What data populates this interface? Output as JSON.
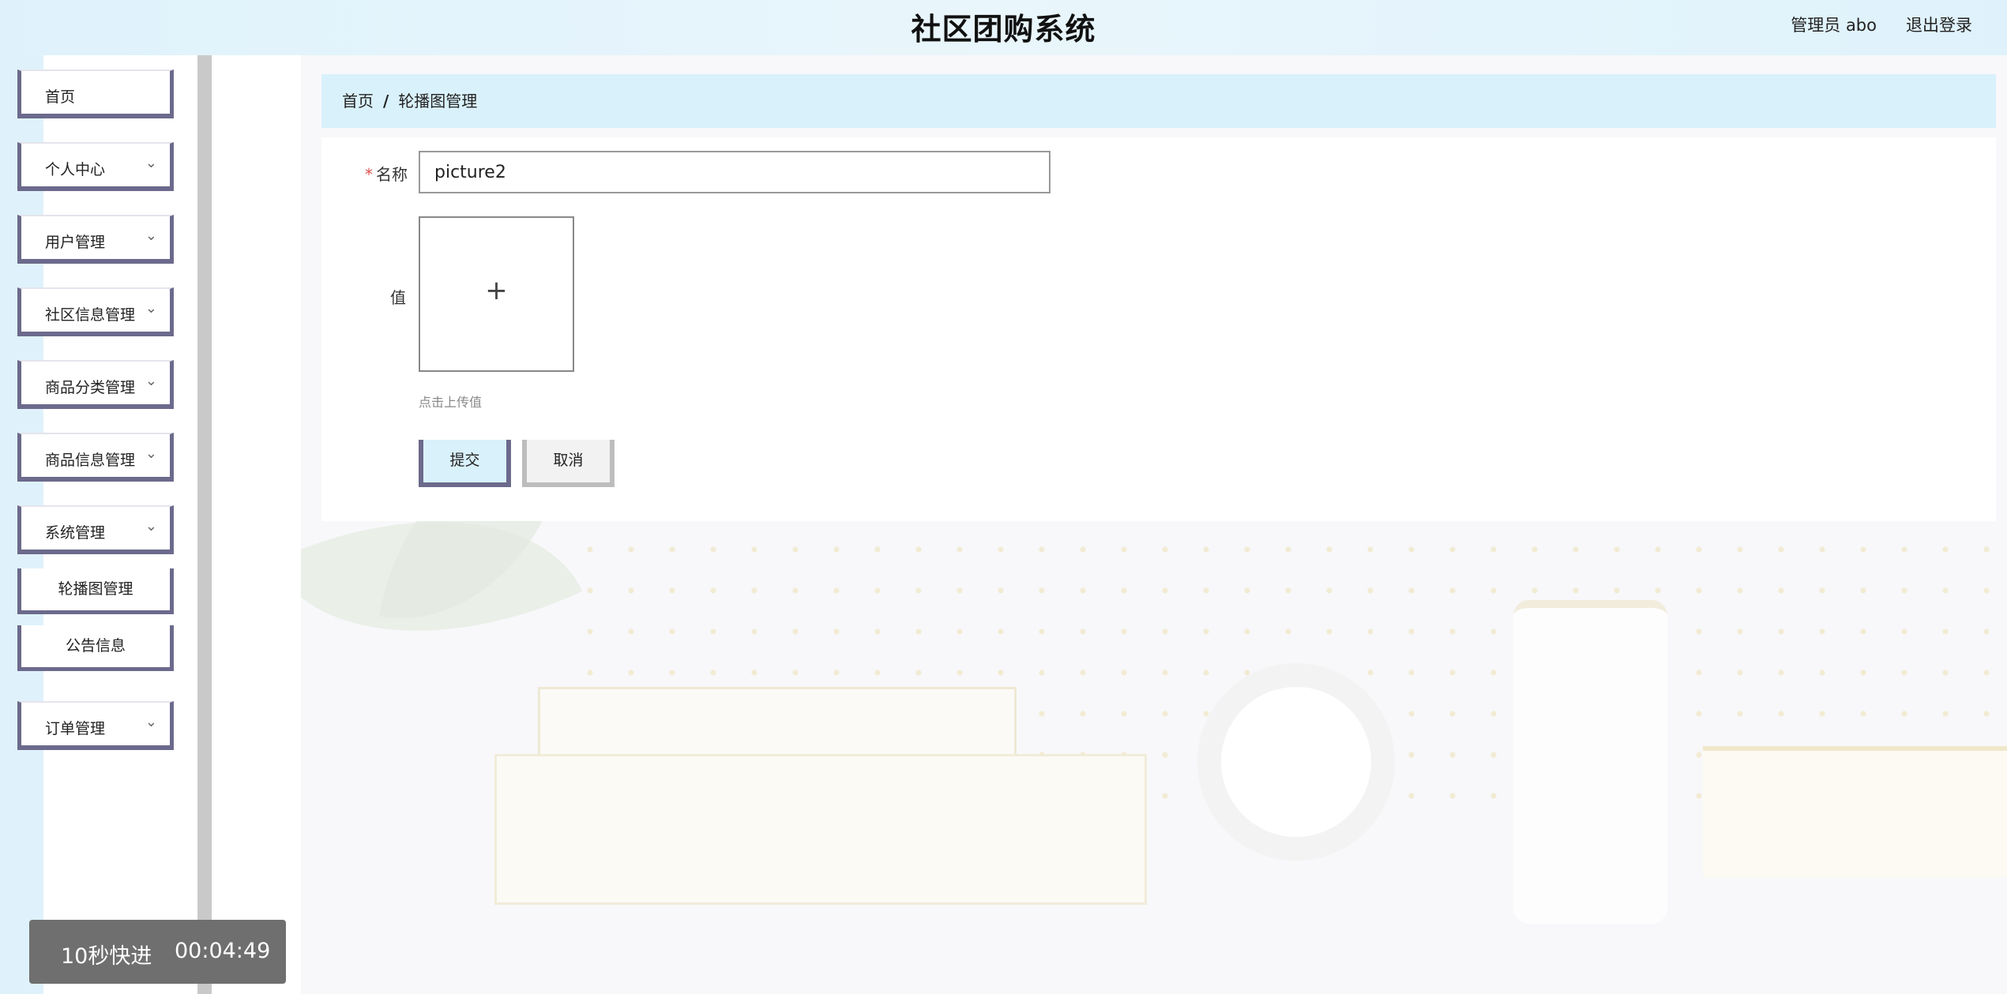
{
  "header": {
    "title": "社区团购系统",
    "user": "管理员 abo",
    "logout": "退出登录"
  },
  "sidebar": {
    "items": [
      {
        "label": "首页",
        "expandable": false
      },
      {
        "label": "个人中心",
        "expandable": true
      },
      {
        "label": "用户管理",
        "expandable": true
      },
      {
        "label": "社区信息管理",
        "expandable": true
      },
      {
        "label": "商品分类管理",
        "expandable": true
      },
      {
        "label": "商品信息管理",
        "expandable": true
      },
      {
        "label": "系统管理",
        "expandable": true
      },
      {
        "label": "订单管理",
        "expandable": true
      }
    ],
    "subitems": [
      {
        "label": "轮播图管理"
      },
      {
        "label": "公告信息"
      }
    ],
    "chevron": "chevron-down-icon"
  },
  "breadcrumb": {
    "home": "首页",
    "separator": "/",
    "current": "轮播图管理"
  },
  "form": {
    "name_label": "名称",
    "required_mark": "*",
    "name_value": "picture2",
    "value_label": "值",
    "upload_plus": "+",
    "upload_hint": "点击上传值",
    "submit": "提交",
    "cancel": "取消"
  },
  "overlay": {
    "fast_forward": "10秒快进",
    "time": "00:04:49"
  },
  "colors": {
    "accent": "#6c6a8c",
    "header_bg": "#dff2fb",
    "breadcrumb_bg": "#d9f1fb",
    "required": "#e05252"
  }
}
